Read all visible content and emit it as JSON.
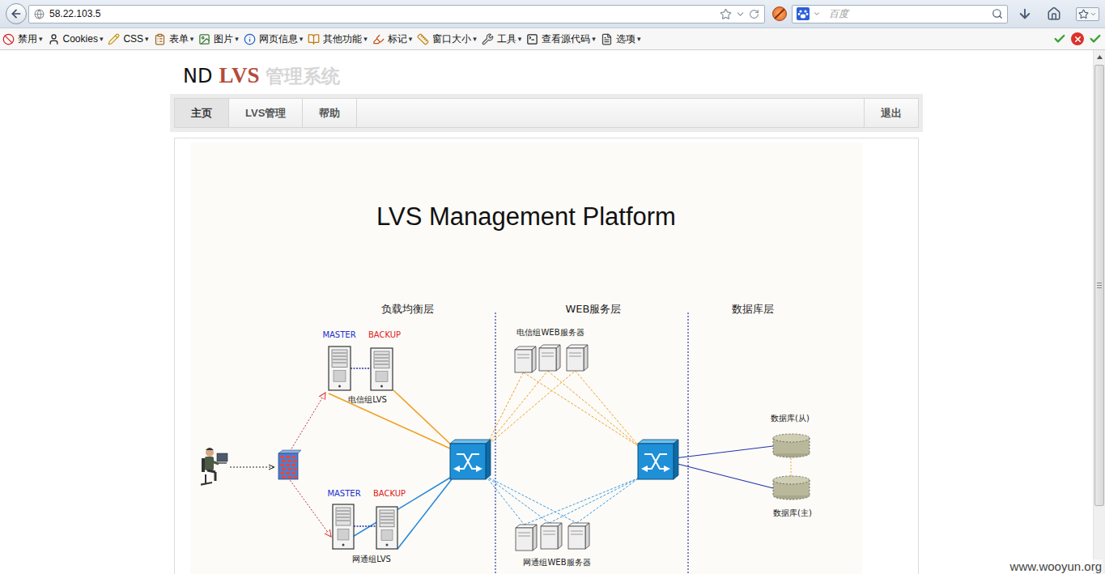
{
  "browser": {
    "address": "58.22.103.5",
    "search_placeholder": "百度"
  },
  "dev_toolbar": {
    "dropdown_mark": "▾",
    "items": [
      {
        "label": "禁用"
      },
      {
        "label": "Cookies"
      },
      {
        "label": "CSS"
      },
      {
        "label": "表单"
      },
      {
        "label": "图片"
      },
      {
        "label": "网页信息"
      },
      {
        "label": "其他功能"
      },
      {
        "label": "标记"
      },
      {
        "label": "窗口大小"
      },
      {
        "label": "工具"
      },
      {
        "label": "查看源代码"
      },
      {
        "label": "选项"
      }
    ]
  },
  "page": {
    "logo": {
      "prefix": "ND",
      "highlight": "LVS",
      "suffix": "管理系统"
    },
    "nav": [
      {
        "label": "主页",
        "selected": true
      },
      {
        "label": "LVS管理",
        "selected": false
      },
      {
        "label": "帮助",
        "selected": false
      }
    ],
    "logout": "退出",
    "banner_title": "LVS Management Platform",
    "diagram": {
      "layers": [
        "负载均衡层",
        "WEB服务层",
        "数据库层"
      ],
      "lvs_groups": [
        {
          "name": "电信组LVS",
          "color": "#f0a020",
          "roles": [
            {
              "label": "MASTER",
              "color": "#1a2fd0"
            },
            {
              "label": "BACKUP",
              "color": "#e02020"
            }
          ]
        },
        {
          "name": "网通组LVS",
          "color": "#2a8ad8",
          "roles": [
            {
              "label": "MASTER",
              "color": "#1a2fd0"
            },
            {
              "label": "BACKUP",
              "color": "#e02020"
            }
          ]
        }
      ],
      "web_groups": [
        {
          "name": "电信组WEB服务器",
          "color": "#f0a020"
        },
        {
          "name": "网通组WEB服务器",
          "color": "#3a9ae0"
        }
      ],
      "databases": [
        "数据库(从)",
        "数据库(主)"
      ]
    }
  },
  "scrollbar": {
    "level": 0.87
  },
  "watermark": "www.wooyun.org"
}
